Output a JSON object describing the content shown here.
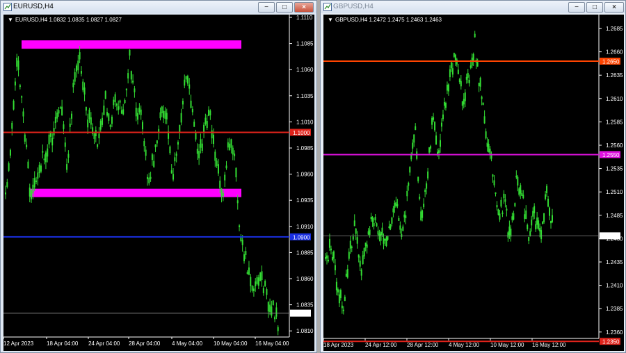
{
  "windows": [
    {
      "title": "EURUSD,H4",
      "symbol_line": "EURUSD,H4  1.0832 1.0835 1.0827 1.0827",
      "price_axis": [
        "1.1110",
        "1.1085",
        "1.1060",
        "1.1035",
        "1.1010",
        "1.0985",
        "1.0960",
        "1.0935",
        "1.0910",
        "1.0885",
        "1.0860",
        "1.0835",
        "1.0810"
      ],
      "time_axis": [
        "12 Apr 2023",
        "18 Apr 04:00",
        "24 Apr 04:00",
        "28 Apr 04:00",
        "4 May 04:00",
        "10 May 04:00",
        "16 May 04:00"
      ],
      "levels": [
        {
          "label": "1.1000",
          "color": "#e0231b"
        },
        {
          "label": "1.0900",
          "color": "#1a2fe0"
        },
        {
          "label": "1.0827",
          "color": "#8a8a8a"
        }
      ],
      "zones": [
        {
          "from": 1.108,
          "to": 1.1088,
          "color": "#ff00ff"
        },
        {
          "from": 1.0938,
          "to": 1.0946,
          "color": "#ff00ff"
        }
      ],
      "current_price": "1.0827"
    },
    {
      "title": "GBPUSD,H4",
      "symbol_line": "GBPUSD,H4  1.2472 1.2475 1.2463 1.2463",
      "price_axis": [
        "1.2685",
        "1.2660",
        "1.2635",
        "1.2610",
        "1.2585",
        "1.2560",
        "1.2535",
        "1.2510",
        "1.2485",
        "1.2460",
        "1.2435",
        "1.2410",
        "1.2385",
        "1.2360"
      ],
      "time_axis": [
        "18 Apr 2023",
        "24 Apr 12:00",
        "28 Apr 12:00",
        "4 May 12:00",
        "10 May 12:00",
        "16 May 12:00"
      ],
      "levels": [
        {
          "label": "1.2650",
          "color": "#ff4400"
        },
        {
          "label": "1.2550",
          "color": "#e010e0"
        },
        {
          "label": "1.2463",
          "color": "#8a8a8a"
        },
        {
          "label": "1.2350",
          "color": "#e0231b"
        }
      ],
      "current_price": "1.2463"
    }
  ],
  "controls": {
    "minimize": "−",
    "maximize": "□",
    "close": "×"
  },
  "colors": {
    "candles": "#33dd33",
    "background": "#000000"
  }
}
